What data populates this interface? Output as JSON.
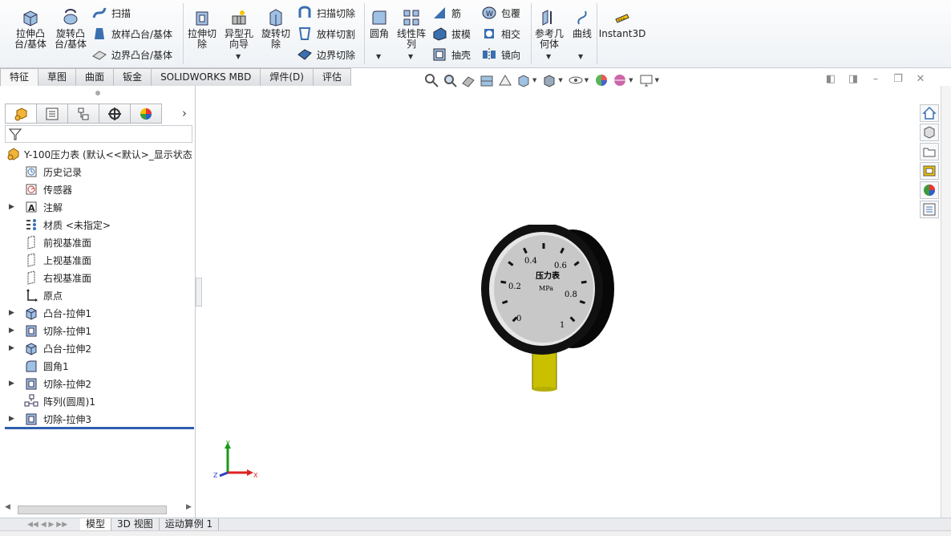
{
  "ribbon": {
    "extrude_boss": "拉伸凸\n台/基体",
    "revolve_boss": "旋转凸\n台/基体",
    "sweep": "扫描",
    "loft_boss": "放样凸台/基体",
    "boundary_boss": "边界凸台/基体",
    "extrude_cut": "拉伸切\n除",
    "hole_wizard": "异型孔\n向导",
    "revolve_cut": "旋转切\n除",
    "sweep_cut": "扫描切除",
    "loft_cut": "放样切割",
    "boundary_cut": "边界切除",
    "fillet": "圆角",
    "linear_pattern": "线性阵\n列",
    "rib": "筋",
    "draft": "拔模",
    "shell": "抽壳",
    "wrap": "包覆",
    "intersect": "相交",
    "mirror": "镜向",
    "ref_geometry": "参考几\n何体",
    "curves": "曲线",
    "instant3d": "Instant3D"
  },
  "tabs": [
    {
      "label": "特征",
      "active": true
    },
    {
      "label": "草图",
      "active": false
    },
    {
      "label": "曲面",
      "active": false
    },
    {
      "label": "钣金",
      "active": false
    },
    {
      "label": "SOLIDWORKS MBD",
      "active": false
    },
    {
      "label": "焊件(D)",
      "active": false
    },
    {
      "label": "评估",
      "active": false
    }
  ],
  "tree": {
    "root": "Y-100压力表 (默认<<默认>_显示状态",
    "items": [
      {
        "label": "历史记录",
        "icon": "history-icon",
        "expandable": false
      },
      {
        "label": "传感器",
        "icon": "sensor-icon",
        "expandable": false
      },
      {
        "label": "注解",
        "icon": "annotation-icon",
        "expandable": true
      },
      {
        "label": "材质 <未指定>",
        "icon": "material-icon",
        "expandable": false
      },
      {
        "label": "前视基准面",
        "icon": "plane-icon",
        "expandable": false
      },
      {
        "label": "上视基准面",
        "icon": "plane-icon",
        "expandable": false
      },
      {
        "label": "右视基准面",
        "icon": "plane-icon",
        "expandable": false
      },
      {
        "label": "原点",
        "icon": "origin-icon",
        "expandable": false
      },
      {
        "label": "凸台-拉伸1",
        "icon": "boss-extrude-icon",
        "expandable": true
      },
      {
        "label": "切除-拉伸1",
        "icon": "cut-extrude-icon",
        "expandable": true
      },
      {
        "label": "凸台-拉伸2",
        "icon": "boss-extrude-icon",
        "expandable": true
      },
      {
        "label": "圆角1",
        "icon": "fillet-icon",
        "expandable": false
      },
      {
        "label": "切除-拉伸2",
        "icon": "cut-extrude-icon",
        "expandable": true
      },
      {
        "label": "阵列(圆周)1",
        "icon": "circular-pattern-icon",
        "expandable": false
      },
      {
        "label": "切除-拉伸3",
        "icon": "cut-extrude-icon",
        "expandable": true
      }
    ]
  },
  "bottom_tabs": [
    {
      "label": "模型",
      "active": true
    },
    {
      "label": "3D 视图",
      "active": false
    },
    {
      "label": "运动算例 1",
      "active": false
    }
  ],
  "gauge": {
    "title": "压力表",
    "unit": "MPa",
    "scale": [
      "0",
      "0.2",
      "0.4",
      "0.6",
      "0.8",
      "1"
    ]
  },
  "triad": {
    "x": "X",
    "y": "Y",
    "z": "Z"
  },
  "colors": {
    "accent": "#2f5fae",
    "pipe": "#c9c000",
    "gauge_face": "#c8c8c8"
  }
}
